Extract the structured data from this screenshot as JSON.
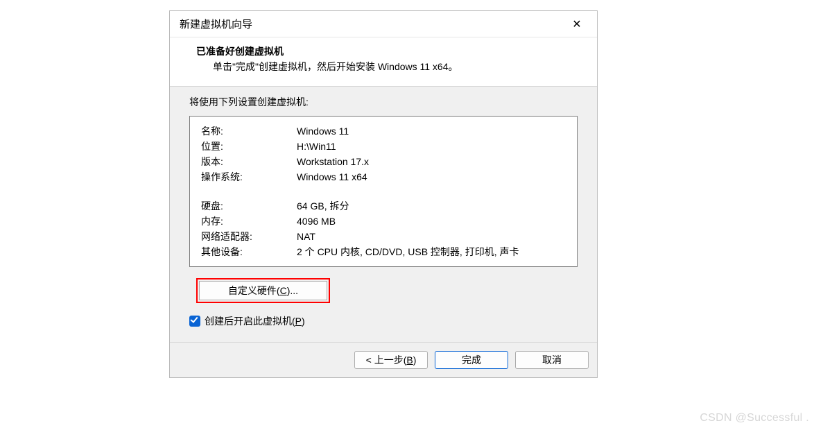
{
  "titlebar": {
    "title": "新建虚拟机向导"
  },
  "header": {
    "heading": "已准备好创建虚拟机",
    "subheading": "单击\"完成\"创建虚拟机，然后开始安装 Windows 11 x64。"
  },
  "body": {
    "label": "将使用下列设置创建虚拟机:",
    "group1": [
      {
        "k": "名称:",
        "v": "Windows 11"
      },
      {
        "k": "位置:",
        "v": "H:\\Win11"
      },
      {
        "k": "版本:",
        "v": "Workstation 17.x"
      },
      {
        "k": "操作系统:",
        "v": "Windows 11 x64"
      }
    ],
    "group2": [
      {
        "k": "硬盘:",
        "v": "64 GB, 拆分"
      },
      {
        "k": "内存:",
        "v": "4096 MB"
      },
      {
        "k": "网络适配器:",
        "v": "NAT"
      },
      {
        "k": "其他设备:",
        "v": "2 个 CPU 内核, CD/DVD, USB 控制器, 打印机, 声卡"
      }
    ],
    "customize_prefix": "自定义硬件(",
    "customize_key": "C",
    "customize_suffix": ")...",
    "checkbox_prefix": "创建后开启此虚拟机(",
    "checkbox_key": "P",
    "checkbox_suffix": ")"
  },
  "footer": {
    "back_prefix": "< 上一步(",
    "back_key": "B",
    "back_suffix": ")",
    "finish": "完成",
    "cancel": "取消"
  },
  "watermark": "CSDN @Successful ."
}
